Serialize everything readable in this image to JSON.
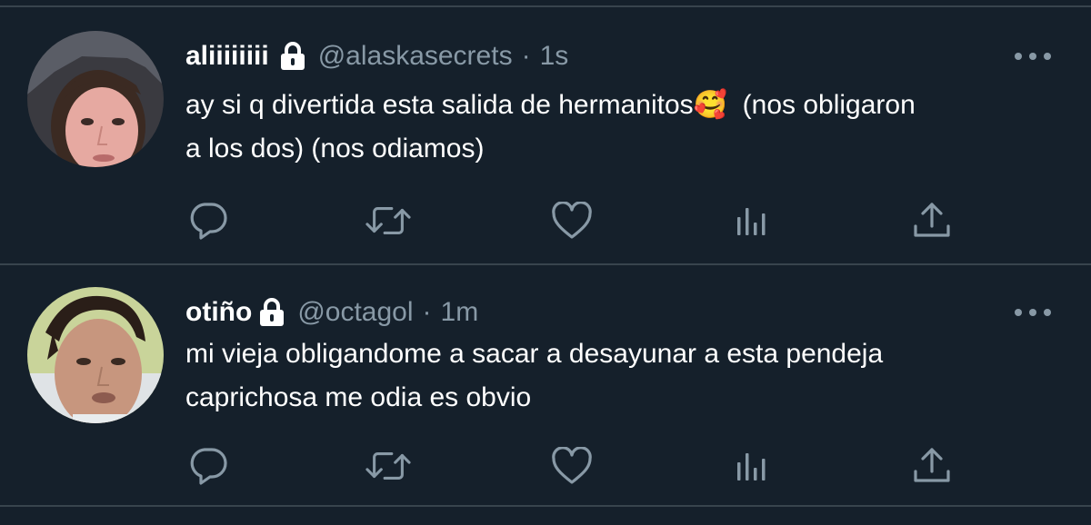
{
  "tweets": [
    {
      "display_name": "aliiiiiiii",
      "handle": "@alaskasecrets",
      "separator": "·",
      "time": "1s",
      "text": "ay si q divertida esta salida de hermanitos🥰  (nos obligaron\na los dos) (nos odiamos)",
      "icons": [
        "lock-icon",
        "more-icon",
        "reply-icon",
        "retweet-icon",
        "like-icon",
        "analytics-icon",
        "share-icon"
      ]
    },
    {
      "display_name": "otiño",
      "handle": "@octagol",
      "separator": "·",
      "time": "1m",
      "text": "mi vieja obligandome a sacar a desayunar a esta pendeja\ncaprichosa me odia es obvio",
      "icons": [
        "lock-icon",
        "more-icon",
        "reply-icon",
        "retweet-icon",
        "like-icon",
        "analytics-icon",
        "share-icon"
      ]
    }
  ],
  "colors": {
    "background": "#15202b",
    "divider": "#38444d",
    "secondary_text": "#8899a6",
    "primary_text": "#ffffff"
  }
}
